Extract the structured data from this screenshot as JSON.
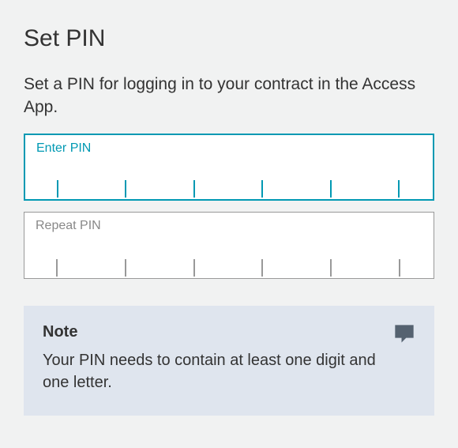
{
  "title": "Set PIN",
  "description": "Set a PIN for logging in to your contract in the Access App.",
  "fields": {
    "enter_label": "Enter PIN",
    "repeat_label": "Repeat PIN"
  },
  "note": {
    "title": "Note",
    "text": "Your PIN needs to contain at least one digit and one letter."
  }
}
